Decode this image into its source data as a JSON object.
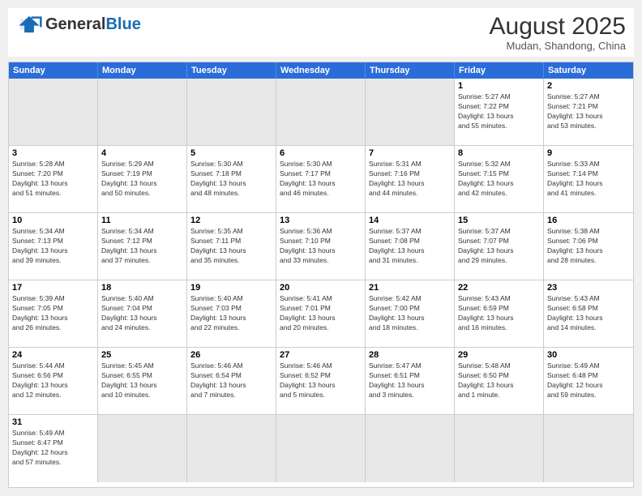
{
  "header": {
    "logo_general": "General",
    "logo_blue": "Blue",
    "month_year": "August 2025",
    "location": "Mudan, Shandong, China"
  },
  "days_of_week": [
    "Sunday",
    "Monday",
    "Tuesday",
    "Wednesday",
    "Thursday",
    "Friday",
    "Saturday"
  ],
  "weeks": [
    [
      {
        "day": "",
        "info": ""
      },
      {
        "day": "",
        "info": ""
      },
      {
        "day": "",
        "info": ""
      },
      {
        "day": "",
        "info": ""
      },
      {
        "day": "",
        "info": ""
      },
      {
        "day": "1",
        "info": "Sunrise: 5:27 AM\nSunset: 7:22 PM\nDaylight: 13 hours\nand 55 minutes."
      },
      {
        "day": "2",
        "info": "Sunrise: 5:27 AM\nSunset: 7:21 PM\nDaylight: 13 hours\nand 53 minutes."
      }
    ],
    [
      {
        "day": "3",
        "info": "Sunrise: 5:28 AM\nSunset: 7:20 PM\nDaylight: 13 hours\nand 51 minutes."
      },
      {
        "day": "4",
        "info": "Sunrise: 5:29 AM\nSunset: 7:19 PM\nDaylight: 13 hours\nand 50 minutes."
      },
      {
        "day": "5",
        "info": "Sunrise: 5:30 AM\nSunset: 7:18 PM\nDaylight: 13 hours\nand 48 minutes."
      },
      {
        "day": "6",
        "info": "Sunrise: 5:30 AM\nSunset: 7:17 PM\nDaylight: 13 hours\nand 46 minutes."
      },
      {
        "day": "7",
        "info": "Sunrise: 5:31 AM\nSunset: 7:16 PM\nDaylight: 13 hours\nand 44 minutes."
      },
      {
        "day": "8",
        "info": "Sunrise: 5:32 AM\nSunset: 7:15 PM\nDaylight: 13 hours\nand 42 minutes."
      },
      {
        "day": "9",
        "info": "Sunrise: 5:33 AM\nSunset: 7:14 PM\nDaylight: 13 hours\nand 41 minutes."
      }
    ],
    [
      {
        "day": "10",
        "info": "Sunrise: 5:34 AM\nSunset: 7:13 PM\nDaylight: 13 hours\nand 39 minutes."
      },
      {
        "day": "11",
        "info": "Sunrise: 5:34 AM\nSunset: 7:12 PM\nDaylight: 13 hours\nand 37 minutes."
      },
      {
        "day": "12",
        "info": "Sunrise: 5:35 AM\nSunset: 7:11 PM\nDaylight: 13 hours\nand 35 minutes."
      },
      {
        "day": "13",
        "info": "Sunrise: 5:36 AM\nSunset: 7:10 PM\nDaylight: 13 hours\nand 33 minutes."
      },
      {
        "day": "14",
        "info": "Sunrise: 5:37 AM\nSunset: 7:08 PM\nDaylight: 13 hours\nand 31 minutes."
      },
      {
        "day": "15",
        "info": "Sunrise: 5:37 AM\nSunset: 7:07 PM\nDaylight: 13 hours\nand 29 minutes."
      },
      {
        "day": "16",
        "info": "Sunrise: 5:38 AM\nSunset: 7:06 PM\nDaylight: 13 hours\nand 28 minutes."
      }
    ],
    [
      {
        "day": "17",
        "info": "Sunrise: 5:39 AM\nSunset: 7:05 PM\nDaylight: 13 hours\nand 26 minutes."
      },
      {
        "day": "18",
        "info": "Sunrise: 5:40 AM\nSunset: 7:04 PM\nDaylight: 13 hours\nand 24 minutes."
      },
      {
        "day": "19",
        "info": "Sunrise: 5:40 AM\nSunset: 7:03 PM\nDaylight: 13 hours\nand 22 minutes."
      },
      {
        "day": "20",
        "info": "Sunrise: 5:41 AM\nSunset: 7:01 PM\nDaylight: 13 hours\nand 20 minutes."
      },
      {
        "day": "21",
        "info": "Sunrise: 5:42 AM\nSunset: 7:00 PM\nDaylight: 13 hours\nand 18 minutes."
      },
      {
        "day": "22",
        "info": "Sunrise: 5:43 AM\nSunset: 6:59 PM\nDaylight: 13 hours\nand 16 minutes."
      },
      {
        "day": "23",
        "info": "Sunrise: 5:43 AM\nSunset: 6:58 PM\nDaylight: 13 hours\nand 14 minutes."
      }
    ],
    [
      {
        "day": "24",
        "info": "Sunrise: 5:44 AM\nSunset: 6:56 PM\nDaylight: 13 hours\nand 12 minutes."
      },
      {
        "day": "25",
        "info": "Sunrise: 5:45 AM\nSunset: 6:55 PM\nDaylight: 13 hours\nand 10 minutes."
      },
      {
        "day": "26",
        "info": "Sunrise: 5:46 AM\nSunset: 6:54 PM\nDaylight: 13 hours\nand 7 minutes."
      },
      {
        "day": "27",
        "info": "Sunrise: 5:46 AM\nSunset: 6:52 PM\nDaylight: 13 hours\nand 5 minutes."
      },
      {
        "day": "28",
        "info": "Sunrise: 5:47 AM\nSunset: 6:51 PM\nDaylight: 13 hours\nand 3 minutes."
      },
      {
        "day": "29",
        "info": "Sunrise: 5:48 AM\nSunset: 6:50 PM\nDaylight: 13 hours\nand 1 minute."
      },
      {
        "day": "30",
        "info": "Sunrise: 5:49 AM\nSunset: 6:48 PM\nDaylight: 12 hours\nand 59 minutes."
      }
    ],
    [
      {
        "day": "31",
        "info": "Sunrise: 5:49 AM\nSunset: 6:47 PM\nDaylight: 12 hours\nand 57 minutes."
      },
      {
        "day": "",
        "info": ""
      },
      {
        "day": "",
        "info": ""
      },
      {
        "day": "",
        "info": ""
      },
      {
        "day": "",
        "info": ""
      },
      {
        "day": "",
        "info": ""
      },
      {
        "day": "",
        "info": ""
      }
    ]
  ]
}
